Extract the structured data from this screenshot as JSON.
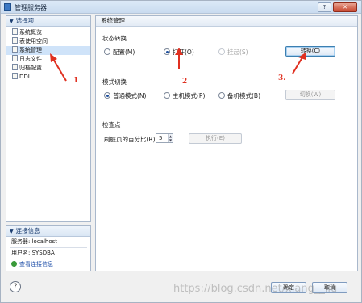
{
  "window": {
    "title": "管理服务器",
    "help_glyph": "?",
    "close_glyph": "✕"
  },
  "left_panel": {
    "header": "选择项",
    "items": [
      {
        "label": "系统概览",
        "selected": false
      },
      {
        "label": "表使用空间",
        "selected": false
      },
      {
        "label": "系统管理",
        "selected": true
      },
      {
        "label": "日志文件",
        "selected": false
      },
      {
        "label": "归档配置",
        "selected": false
      },
      {
        "label": "DDL",
        "selected": false
      }
    ]
  },
  "connection": {
    "header": "连接信息",
    "server_line": "服务器: localhost",
    "user_line": "用户名: SYSDBA",
    "view_link": "查看连接信息"
  },
  "main": {
    "header": "系统管理",
    "state_switch": {
      "label": "状态转换",
      "options": [
        {
          "label": "配置(M)",
          "checked": false,
          "enabled": true
        },
        {
          "label": "打开(O)",
          "checked": true,
          "enabled": true
        },
        {
          "label": "挂起(S)",
          "checked": false,
          "enabled": false
        }
      ],
      "button": "转换(C)"
    },
    "mode_switch": {
      "label": "模式切换",
      "options": [
        {
          "label": "普通模式(N)",
          "checked": true,
          "enabled": true
        },
        {
          "label": "主机模式(P)",
          "checked": false,
          "enabled": true
        },
        {
          "label": "备机模式(B)",
          "checked": false,
          "enabled": true
        }
      ],
      "button": "切换(W)"
    },
    "checkpoint": {
      "label": "检查点",
      "field_label": "刷脏页的百分比(R):",
      "field_value": "5",
      "button": "执行(E)"
    }
  },
  "footer": {
    "help_glyph": "?",
    "ok_button": "确定",
    "cancel_button": "取消"
  },
  "annotations": {
    "markers": [
      "1",
      "2",
      "3."
    ],
    "color": "#e03020"
  },
  "watermark": "https://blog.csdn.net/xiang__liu"
}
